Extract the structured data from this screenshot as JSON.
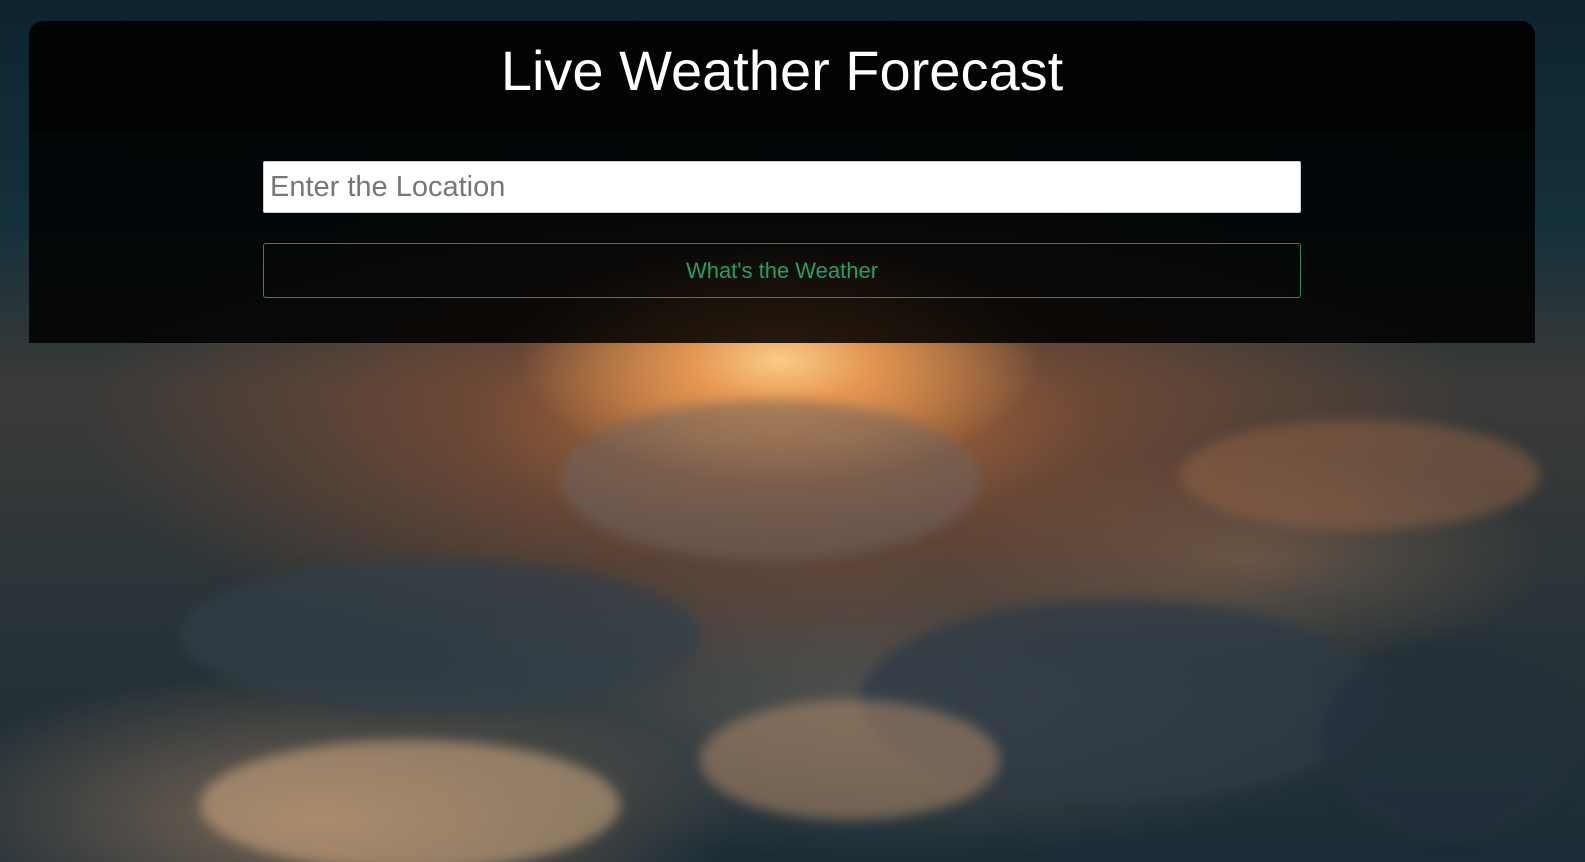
{
  "header": {
    "title": "Live Weather Forecast"
  },
  "search": {
    "placeholder": "Enter the Location",
    "value": ""
  },
  "actions": {
    "submit_label": "What's the Weather"
  },
  "colors": {
    "panel_background": "#000000",
    "button_accent": "#23a063",
    "title_text": "#ffffff"
  }
}
